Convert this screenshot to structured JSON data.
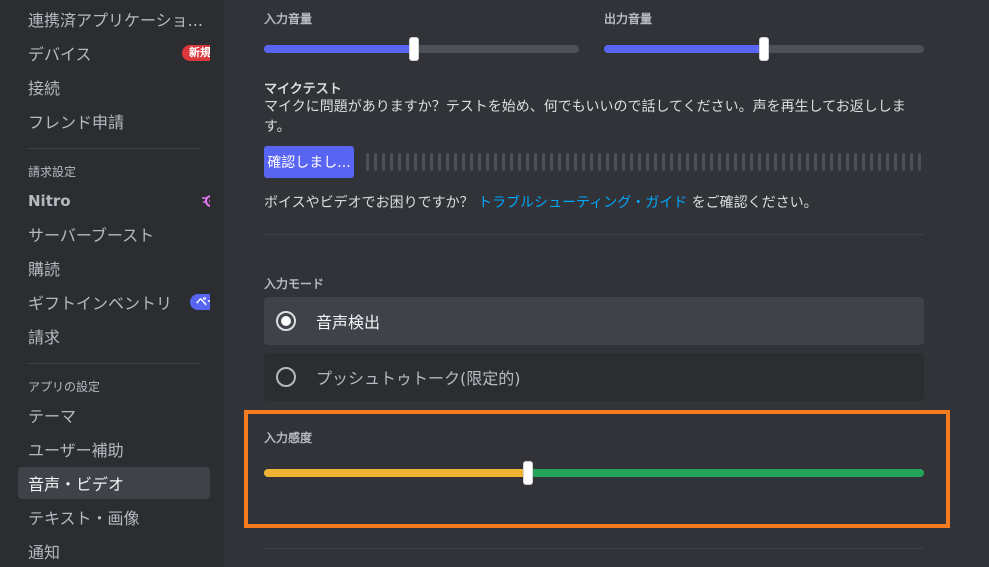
{
  "sidebar": {
    "items_top": [
      {
        "label": "連携済アプリケーショ..."
      },
      {
        "label": "デバイス",
        "badge": "新規"
      },
      {
        "label": "接続"
      },
      {
        "label": "フレンド申請"
      }
    ],
    "billing_header": "請求設定",
    "billing_items": [
      {
        "label": "Nitro",
        "icon": "nitro-icon"
      },
      {
        "label": "サーバーブースト"
      },
      {
        "label": "購読"
      },
      {
        "label": "ギフトインベントリ",
        "badge": "ベータ"
      },
      {
        "label": "請求"
      }
    ],
    "app_header": "アプリの設定",
    "app_items": [
      {
        "label": "テーマ"
      },
      {
        "label": "ユーザー補助"
      },
      {
        "label": "音声・ビデオ",
        "active": true
      },
      {
        "label": "テキスト・画像"
      },
      {
        "label": "通知"
      }
    ]
  },
  "voice": {
    "input_volume_label": "入力音量",
    "input_volume_fraction": 0.476,
    "output_volume_label": "出力音量",
    "output_volume_fraction": 0.5,
    "mic_test_title": "マイクテスト",
    "mic_test_desc": "マイクに問題がありますか？テストを始め、何でもいいので話してください。声を再生してお返しします。",
    "mic_test_button": "確認しまし...",
    "help_prefix": "ボイスやビデオでお困りですか？",
    "help_link": "トラブルシューティング・ガイド",
    "help_suffix": "をご確認ください。",
    "input_mode_label": "入力モード",
    "input_modes": [
      {
        "label": "音声検出",
        "selected": true
      },
      {
        "label": "プッシュトゥトーク(限定的)",
        "selected": false
      }
    ],
    "sensitivity_label": "入力感度",
    "sensitivity_fraction": 0.4
  },
  "colors": {
    "accent": "#5865f2",
    "sensitivity_low": "#f0b232",
    "sensitivity_high": "#23a559",
    "highlight": "#f47b20",
    "link": "#00a8fc"
  }
}
